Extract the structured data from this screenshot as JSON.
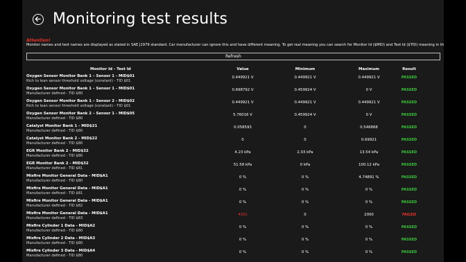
{
  "page": {
    "title": "Monitoring test results",
    "attention_label": "Attention!",
    "note": "Monitor names and test names are displayed as stated in SAE J1979 standard. Car manufacturer can ignore this and have different meaning. To get real meaning you can search for Monitor Id ($MID) and Test Id ($TID) meaning in the Internet.",
    "refresh_label": "Refresh"
  },
  "colors": {
    "passed": "#3cc43c",
    "failed": "#e8322c",
    "attention": "#e8322c"
  },
  "table": {
    "headers": {
      "monitor": "Monitor Id - Test Id",
      "value": "Value",
      "minimum": "Minimum",
      "maximum": "Maximum",
      "result": "Result"
    },
    "rows": [
      {
        "name": "Oxygen Sensor Monitor Bank 1 – Sensor 1 - MID$01",
        "desc": "Rich to lean sensor threshold voltage (constant) - TID $01",
        "value": "0.449921 V",
        "min": "0.449921 V",
        "max": "0.449921 V",
        "result": "PASSED",
        "failed": false
      },
      {
        "name": "Oxygen Sensor Monitor Bank 1 – Sensor 1 - MID$01",
        "desc": "Manufacturer defined - TID $80",
        "value": "0.698792 V",
        "min": "0.459924 V",
        "max": "0 V",
        "result": "PASSED",
        "failed": false
      },
      {
        "name": "Oxygen Sensor Monitor Bank 1 – Sensor 2 - MID$02",
        "desc": "Rich to lean sensor threshold voltage (constant) - TID $01",
        "value": "0.449921 V",
        "min": "0.449921 V",
        "max": "0.449921 V",
        "result": "PASSED",
        "failed": false
      },
      {
        "name": "Oxygen Sensor Monitor Bank 2 – Sensor 1 - MID$05",
        "desc": "Manufacturer defined - TID $80",
        "value": "5.76016 V",
        "min": "0.459924 V",
        "max": "0 V",
        "result": "PASSED",
        "failed": false
      },
      {
        "name": "Catalyst Monitor Bank 1 - MID$21",
        "desc": "Manufacturer defined - TID $80",
        "value": "0.058593",
        "min": "0",
        "max": "0.546868",
        "result": "PASSED",
        "failed": false
      },
      {
        "name": "Catalyst Monitor Bank 2 - MID$22",
        "desc": "Manufacturer defined - TID $80",
        "value": "0",
        "min": "0",
        "max": "0.69921",
        "result": "PASSED",
        "failed": false
      },
      {
        "name": "EGR Monitor Bank 2 - MID$32",
        "desc": "Manufacturer defined - TID $80",
        "value": "4.23 kPa",
        "min": "2.03 kPa",
        "max": "13.54 kPa",
        "result": "PASSED",
        "failed": false
      },
      {
        "name": "EGR Monitor Bank 2 - MID$32",
        "desc": "Manufacturer defined - TID $81",
        "value": "51.58 kPa",
        "min": "0 kPa",
        "max": "100.12 kPa",
        "result": "PASSED",
        "failed": false
      },
      {
        "name": "Misfire Monitor General Data - MID$A1",
        "desc": "Manufacturer defined - TID $80",
        "value": "0 %",
        "min": "0 %",
        "max": "4.74891 %",
        "result": "PASSED",
        "failed": false
      },
      {
        "name": "Misfire Monitor General Data - MID$A1",
        "desc": "Manufacturer defined - TID $81",
        "value": "0 %",
        "min": "0 %",
        "max": "0 %",
        "result": "PASSED",
        "failed": false
      },
      {
        "name": "Misfire Monitor General Data - MID$A1",
        "desc": "Manufacturer defined - TID $82",
        "value": "0 %",
        "min": "0 %",
        "max": "0 %",
        "result": "PASSED",
        "failed": false
      },
      {
        "name": "Misfire Monitor General Data - MID$A1",
        "desc": "Manufacturer defined - TID $83",
        "value": "4302",
        "min": "0",
        "max": "2000",
        "result": "FAILED",
        "failed": true
      },
      {
        "name": "Misfire Cylinder 1 Data - MID$A2",
        "desc": "Manufacturer defined - TID $80",
        "value": "0 %",
        "min": "0 %",
        "max": "0 %",
        "result": "PASSED",
        "failed": false
      },
      {
        "name": "Misfire Cylinder 2 Data - MID$A3",
        "desc": "Manufacturer defined - TID $80",
        "value": "0 %",
        "min": "0 %",
        "max": "0 %",
        "result": "PASSED",
        "failed": false
      },
      {
        "name": "Misfire Cylinder 3 Data - MID$A4",
        "desc": "Manufacturer defined - TID $80",
        "value": "0 %",
        "min": "0 %",
        "max": "0 %",
        "result": "PASSED",
        "failed": false
      }
    ]
  }
}
